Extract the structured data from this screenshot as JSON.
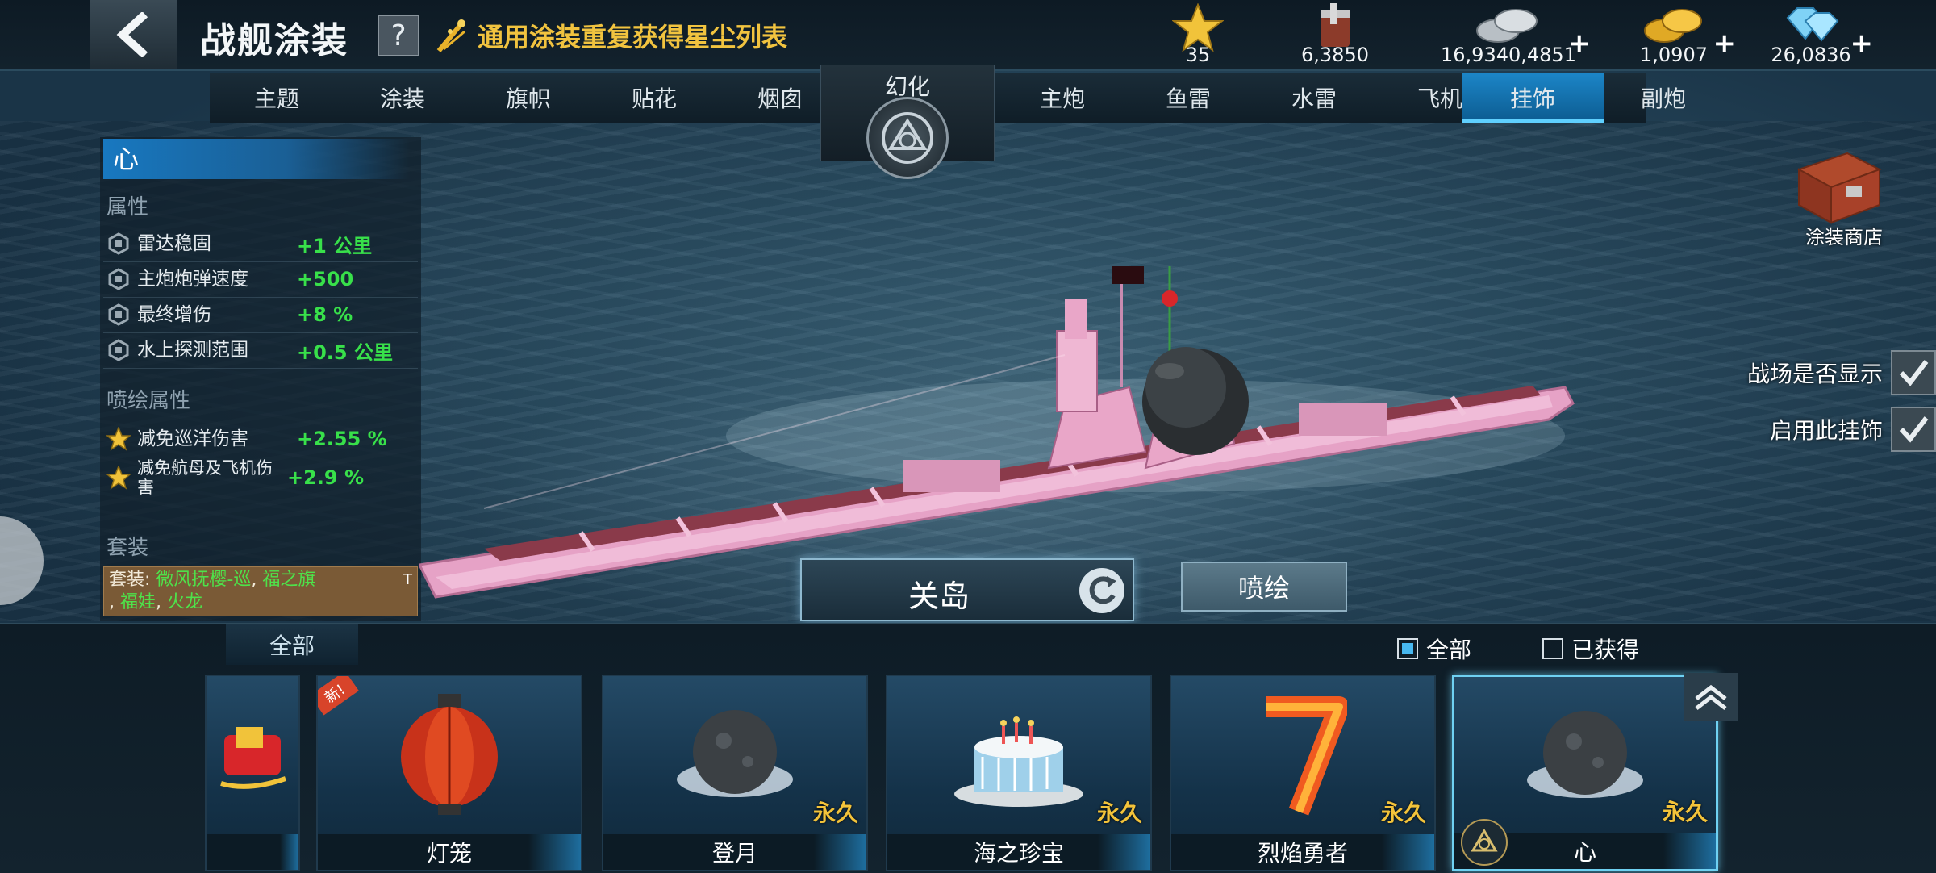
{
  "header": {
    "title": "战舰涂装",
    "help": "?",
    "stardust_link": "通用涂装重复获得星尘列表"
  },
  "currencies": [
    {
      "icon": "star-icon",
      "value": "35",
      "has_plus": false
    },
    {
      "icon": "paint-bucket-icon",
      "value": "6,3850",
      "has_plus": false
    },
    {
      "icon": "silver-coins-icon",
      "value": "16,9340,4851",
      "has_plus": true
    },
    {
      "icon": "gold-coins-icon",
      "value": "1,0907",
      "has_plus": true
    },
    {
      "icon": "diamonds-icon",
      "value": "26,0836",
      "has_plus": true
    }
  ],
  "tabs_left": [
    "主题",
    "涂装",
    "旗帜",
    "贴花",
    "烟囱"
  ],
  "center_tab": "幻化",
  "tabs_right": [
    "主炮",
    "鱼雷",
    "水雷",
    "飞机",
    "挂饰",
    "副炮"
  ],
  "active_tab": "挂饰",
  "attributes": {
    "item_name": "心",
    "section_title": "属性",
    "rows": [
      {
        "name": "雷达稳固",
        "value": "+1 公里"
      },
      {
        "name": "主炮炮弹速度",
        "value": "+500"
      },
      {
        "name": "最终增伤",
        "value": "+8 %"
      },
      {
        "name": "水上探测范围",
        "value": "+0.5 公里"
      }
    ],
    "spray_title": "喷绘属性",
    "spray_rows": [
      {
        "name": "减免巡洋伤害",
        "value": "+2.55 %"
      },
      {
        "name": "减免航母及飞机伤害",
        "value": "+2.9 %"
      }
    ],
    "set_title": "套装",
    "set_prefix": "套装:",
    "set_items": [
      "微风抚樱-巡",
      "福之旗",
      "福娃",
      "火龙"
    ],
    "set_tag": "T"
  },
  "ship": {
    "name": "关岛"
  },
  "buttons": {
    "spray": "喷绘",
    "shop": "涂装商店"
  },
  "toggles": [
    {
      "label": "战场是否显示",
      "checked": true
    },
    {
      "label": "启用此挂饰",
      "checked": true
    }
  ],
  "bottom": {
    "tab_all": "全部",
    "filter_all": "全部",
    "filter_owned": "已获得",
    "filter_all_checked": true,
    "filter_owned_checked": false
  },
  "cards": [
    {
      "name": "",
      "art": "gift-sled-icon",
      "permanent": "",
      "is_new": false,
      "selected": false
    },
    {
      "name": "灯笼",
      "art": "lantern-icon",
      "permanent": "",
      "is_new": true,
      "new_label": "新!",
      "selected": false
    },
    {
      "name": "登月",
      "art": "moon-icon",
      "permanent": "永久",
      "is_new": false,
      "selected": false
    },
    {
      "name": "海之珍宝",
      "art": "cake-icon",
      "permanent": "永久",
      "is_new": false,
      "selected": false
    },
    {
      "name": "烈焰勇者",
      "art": "flaming-seven-icon",
      "permanent": "永久",
      "is_new": false,
      "selected": false
    },
    {
      "name": "心",
      "art": "moon-icon",
      "permanent": "永久",
      "is_new": false,
      "selected": true
    }
  ],
  "colors": {
    "accent_blue": "#1c86c8",
    "value_green": "#38e04a",
    "gold": "#f3c33a",
    "ship_pink": "#e9a6c8"
  }
}
